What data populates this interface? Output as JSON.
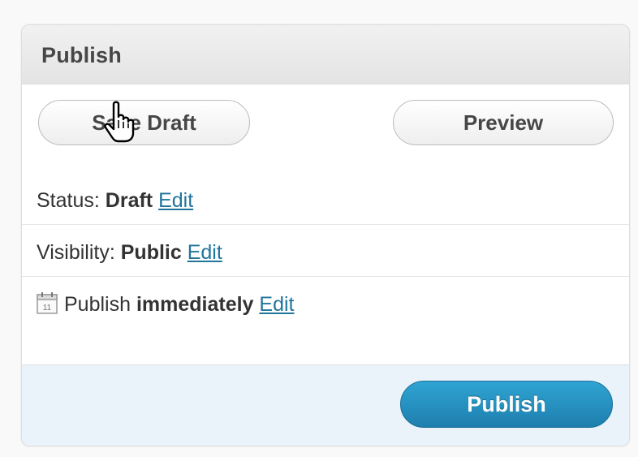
{
  "publish_box": {
    "title": "Publish",
    "save_draft_label": "Save Draft",
    "preview_label": "Preview",
    "status": {
      "label": "Status:",
      "value": "Draft",
      "edit_label": "Edit"
    },
    "visibility": {
      "label": "Visibility:",
      "value": "Public",
      "edit_label": "Edit"
    },
    "schedule": {
      "label": "Publish",
      "value": "immediately",
      "edit_label": "Edit",
      "calendar_day": "11"
    },
    "publish_label": "Publish"
  },
  "colors": {
    "link": "#21759b",
    "publish_button": "#2a95c5",
    "footer_bg": "#eaf2fa",
    "header_bg": "#e9e9e9"
  },
  "icons": [
    "calendar-icon",
    "hand-pointer-cursor"
  ]
}
